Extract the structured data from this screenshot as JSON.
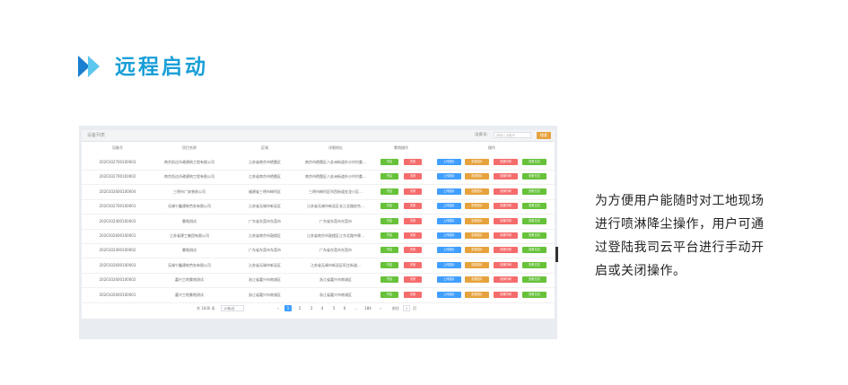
{
  "section": {
    "title": "远程启动",
    "accent": "#1a9fd8"
  },
  "panel": {
    "breadcrumb": "设备列表",
    "search_label": "设备号:",
    "search_placeholder": "请输入设备号",
    "search_button": "搜索",
    "columns": [
      "设备号",
      "项目名称",
      "区域",
      "详细地址",
      "雾炮操作",
      "操作"
    ],
    "rows": [
      {
        "id": "2020102700100003",
        "project": "南京凯达市政建筑工程有限公司",
        "region": "江苏省南京市栖霞区",
        "address": "南京市栖霞区八卦洲街道外沙村村委…"
      },
      {
        "id": "2020102700100002",
        "project": "南京凯达市政建筑工程有限公司",
        "region": "江苏省南京市栖霞区",
        "address": "南京市栖霞区八卦洲街道外沙村村委…"
      },
      {
        "id": "2020102600100004",
        "project": "三明市广安装饰公司",
        "region": "福建省三明市梅列区",
        "address": "三明市梅列区列西街道金龙小区…"
      },
      {
        "id": "2020102700100001",
        "project": "无锡宁鑫建筑劳务有限公司",
        "region": "江苏省无锡市新吴区",
        "address": "江苏省无锡市新吴区长江北路综合…"
      },
      {
        "id": "2020102400100003",
        "project": "雾炮测试",
        "region": "广东省东莞市东莞市",
        "address": "广东省东莞市东莞市"
      },
      {
        "id": "2020102600100001",
        "project": "江苏省建工集团有限公司",
        "region": "江苏省南京市鼓楼区",
        "address": "江苏省南京市鼓楼区江东北路中建…"
      },
      {
        "id": "2020102400100002",
        "project": "雾炮测试",
        "region": "广东省东莞市东莞市",
        "address": "广东省东莞市东莞市"
      },
      {
        "id": "2020102600100003",
        "project": "无锡宁鑫建筑劳务有限公司",
        "region": "江苏省无锡市新吴区",
        "address": "江苏省无锡市新吴区旺庄街道…"
      },
      {
        "id": "2020102600100002",
        "project": "嘉兴工地雾炮测试",
        "region": "浙江省嘉兴市南湖区",
        "address": "浙江省嘉兴市南湖区"
      },
      {
        "id": "2020102600100001",
        "project": "嘉兴工地雾炮测试",
        "region": "浙江省嘉兴市南湖区",
        "address": "浙江省嘉兴市南湖区"
      }
    ],
    "row_buttons": {
      "open": "开启",
      "close": "关闭",
      "a": "上传图片",
      "b": "查看图片",
      "c": "设置时间",
      "d": "查看日志"
    },
    "pager": {
      "total": "共 1836 条",
      "page_size": "10条/页",
      "prev": "‹",
      "next": "›",
      "pages": [
        "1",
        "2",
        "3",
        "4",
        "5",
        "6",
        "…",
        "184"
      ],
      "active": "1",
      "goto_label": "前往",
      "goto_value": "1",
      "goto_suffix": "页"
    }
  },
  "description": "为方便用户能随时对工地现场进行喷淋降尘操作，用户可通过登陆我司云平台进行手动开启或关闭操作。"
}
